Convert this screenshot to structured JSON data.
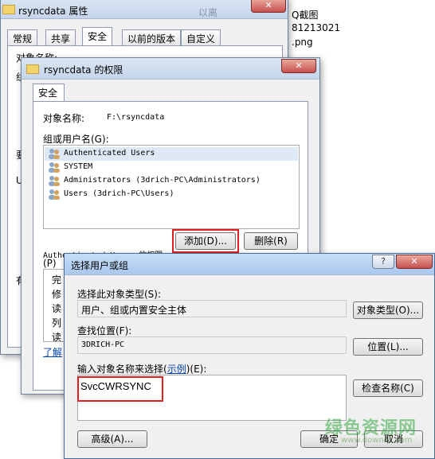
{
  "background_files": [
    "Q截图",
    "81213021",
    ".png"
  ],
  "win1": {
    "title": "rsyncdata 属性",
    "behind_title": "以离",
    "tabs": [
      "常规",
      "共享",
      "安全",
      "以前的版本",
      "自定义"
    ],
    "partial": {
      "obj": "对象名称:",
      "letter_1": "组",
      "letter_2": "要",
      "letter_3": "U",
      "letter_4": "有",
      "link": "了解"
    }
  },
  "win2": {
    "title": "rsyncdata 的权限",
    "tab": "安全",
    "object_label": "对象名称:",
    "object_value": "F:\\rsyncdata",
    "group_label": "组或用户名(G):",
    "users": [
      "Authenticated Users",
      "SYSTEM",
      "Administrators (3drich-PC\\Administrators)",
      "Users (3drich-PC\\Users)"
    ],
    "add_button": "添加(D)...",
    "remove_button": "删除(R)",
    "perm_label": "Authenticated Users 的权限",
    "perm_label_p": "(P)",
    "perm_rows": [
      "完",
      "修",
      "读",
      "列",
      "读"
    ],
    "learn_link": "了解"
  },
  "win3": {
    "title": "选择用户或组",
    "help_btn": "?",
    "close_btn": "✕",
    "type_label": "选择此对象类型(S):",
    "type_value": "用户、组或内置安全主体",
    "type_button": "对象类型(O)...",
    "loc_label": "查找位置(F):",
    "loc_value": "3DRICH-PC",
    "loc_button": "位置(L)...",
    "enter_label_pre": "输入对象名称来选择(",
    "enter_label_link": "示例",
    "enter_label_post": ")(E):",
    "enter_value": "SvcCWRSYNC",
    "check_button": "检查名称(C)",
    "advanced_button": "高级(A)...",
    "ok_button": "确定",
    "cancel_button": "取消"
  },
  "watermark": {
    "text": "绿色资源网",
    "url": "www.downcc.com"
  }
}
